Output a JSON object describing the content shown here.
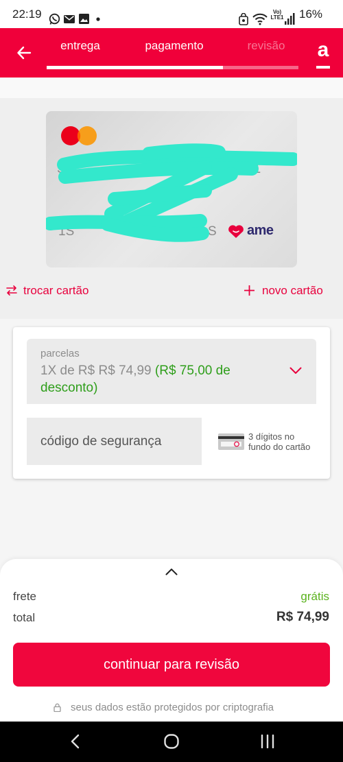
{
  "status_bar": {
    "time": "22:19",
    "network_top": "Vo)",
    "network_bottom": "LTE1",
    "battery": "16%"
  },
  "header": {
    "tabs": [
      {
        "label": "entrega",
        "state": "done"
      },
      {
        "label": "pagamento",
        "state": "active"
      },
      {
        "label": "revisão",
        "state": "disabled"
      }
    ],
    "step_progress": 0.7,
    "logo_letter": "a"
  },
  "card": {
    "number_fragment_left": "S",
    "number_fragment_right": "01",
    "name_fragment_left": "1S",
    "name_fragment_right": "S",
    "brand_wordmark": "ame"
  },
  "card_actions": {
    "swap_label": "trocar cartão",
    "new_label": "novo cartão"
  },
  "payment": {
    "installments": {
      "label": "parcelas",
      "value": "1X de R$ R$ 74,99",
      "discount": "(R$ 75,00 de desconto)"
    },
    "security_code": {
      "placeholder": "código de segurança",
      "hint": "3 dígitos no fundo do cartão"
    }
  },
  "summary": {
    "shipping_label": "frete",
    "shipping_value": "grátis",
    "total_label": "total",
    "total_value": "R$ 74,99"
  },
  "continue_button": {
    "label": "continuar para revisão"
  },
  "security_note": "seus dados estão protegidos por criptografia",
  "icons": {
    "back": "arrow-left-icon",
    "swap": "swap-arrows-icon",
    "add": "plus-icon",
    "dropdown": "chevron-down-icon",
    "expand": "chevron-up-icon",
    "lock": "lock-icon",
    "cvv": "card-back-icon"
  },
  "colors": {
    "brand_red": "#f0003a",
    "success_green": "#2e9e1a",
    "redaction": "#33e8cc"
  }
}
